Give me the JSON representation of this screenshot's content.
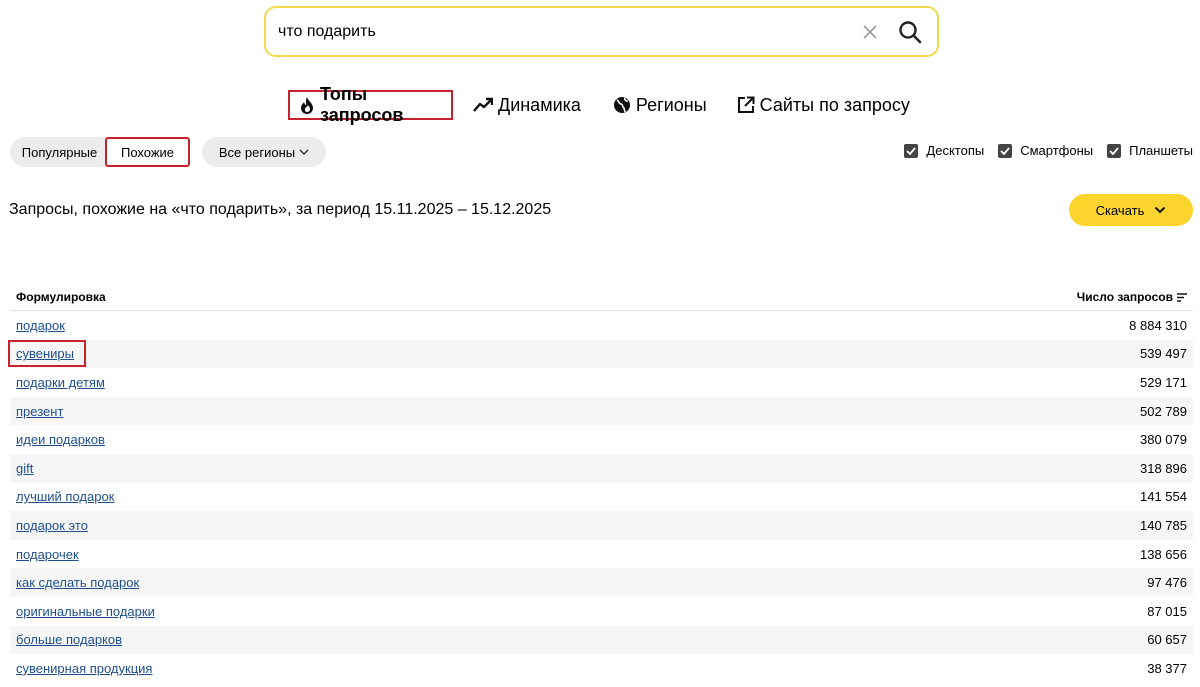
{
  "search": {
    "value": "что подарить",
    "clear_icon": "close-icon",
    "search_icon": "search-icon"
  },
  "tabs": [
    {
      "label": "Топы запросов",
      "icon": "fire-icon",
      "active": true
    },
    {
      "label": "Динамика",
      "icon": "trend-icon"
    },
    {
      "label": "Регионы",
      "icon": "globe-icon"
    },
    {
      "label": "Сайты по запросу",
      "icon": "external-link-icon"
    }
  ],
  "filters": {
    "popular": "Популярные",
    "similar": "Похожие",
    "regions": "Все регионы"
  },
  "devices": [
    {
      "label": "Десктопы",
      "checked": true
    },
    {
      "label": "Смартфоны",
      "checked": true
    },
    {
      "label": "Планшеты",
      "checked": true
    }
  ],
  "heading": "Запросы, похожие на «что подарить», за период 15.11.2025 – 15.12.2025",
  "download_label": "Скачать",
  "table": {
    "col_phrase": "Формулировка",
    "col_count": "Число запросов",
    "rows": [
      {
        "phrase": "подарок",
        "count": "8 884 310"
      },
      {
        "phrase": "сувениры",
        "count": "539 497"
      },
      {
        "phrase": "подарки детям",
        "count": "529 171"
      },
      {
        "phrase": "презент",
        "count": "502 789"
      },
      {
        "phrase": "идеи подарков",
        "count": "380 079"
      },
      {
        "phrase": "gift",
        "count": "318 896"
      },
      {
        "phrase": "лучший подарок",
        "count": "141 554"
      },
      {
        "phrase": "подарок это",
        "count": "140 785"
      },
      {
        "phrase": "подарочек",
        "count": "138 656"
      },
      {
        "phrase": "как сделать подарок",
        "count": "97 476"
      },
      {
        "phrase": "оригинальные подарки",
        "count": "87 015"
      },
      {
        "phrase": "больше подарков",
        "count": "60 657"
      },
      {
        "phrase": "сувенирная продукция",
        "count": "38 377"
      }
    ]
  },
  "colors": {
    "search_border": "#f2d84a",
    "download_bg": "#fbd42d",
    "highlight": "#c8232c",
    "link": "#1f4f8f"
  }
}
